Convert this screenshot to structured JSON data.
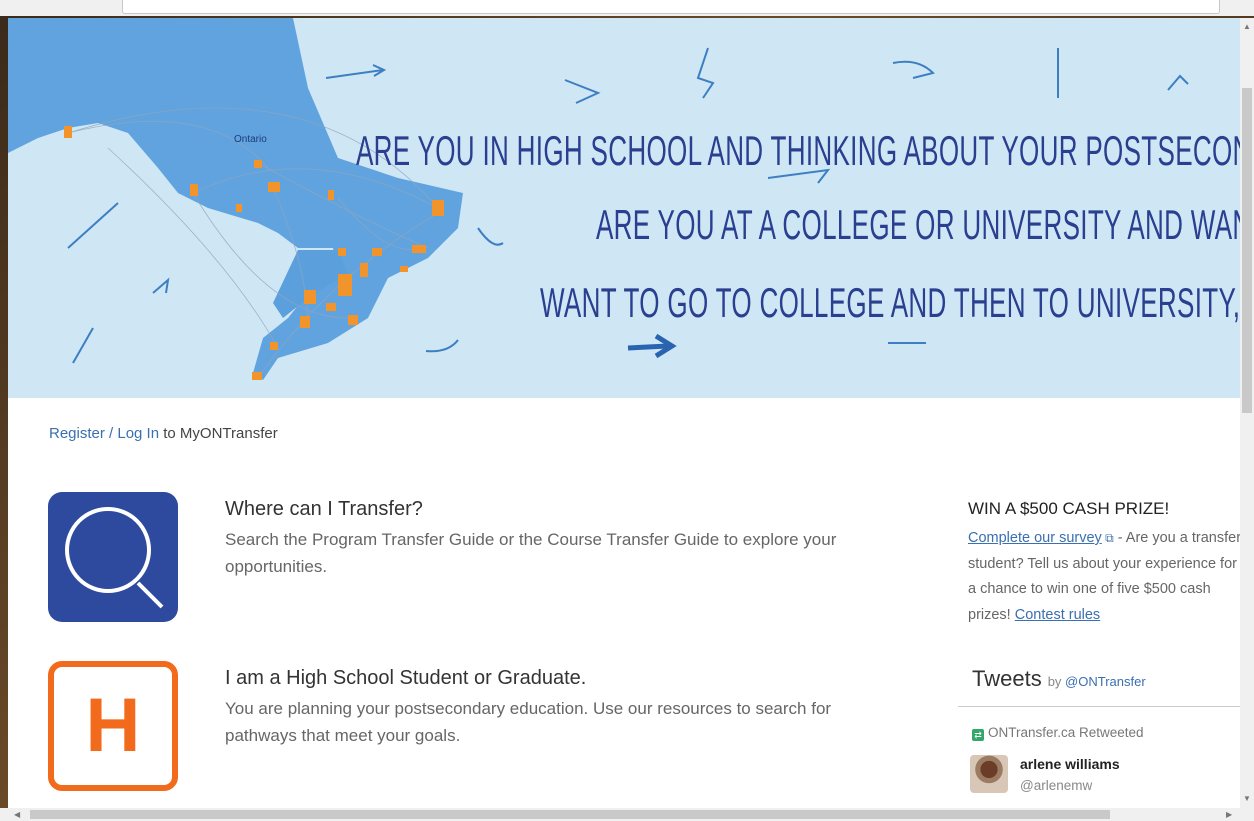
{
  "banner": {
    "region_label": "Ontario",
    "lines": [
      "ARE YOU IN HIGH SCHOOL AND THINKING ABOUT YOUR  POSTSECONDARY EDUCA",
      "ARE YOU AT A COLLEGE OR UNIVERSITY AND WANT TO SWI",
      "WANT TO GO TO COLLEGE AND THEN TO UNIVERSITY, OR VICE-VI"
    ]
  },
  "login": {
    "link_text": "Register / Log In",
    "suffix": " to MyONTransfer"
  },
  "features": [
    {
      "icon": "search-icon",
      "icon_color": "#2e4a9e",
      "title": "Where can I Transfer?",
      "description": "Search the Program Transfer Guide or the Course Transfer Guide to explore your opportunities."
    },
    {
      "icon": "h-letter-icon",
      "icon_letter": "H",
      "icon_color": "#f26a1b",
      "title": "I am a High School Student or Graduate.",
      "description": "You are planning your postsecondary education. Use our resources to search for pathways that meet your goals."
    }
  ],
  "promo": {
    "title": "WIN A $500 CASH PRIZE!",
    "survey_link": "Complete our survey",
    "body": " - Are you a transfer student? Tell us about your experience for a chance to win one of five $500 cash prizes! ",
    "rules_link": "Contest rules"
  },
  "tweets": {
    "title": "Tweets",
    "by_prefix": "by ",
    "handle": "@ONTransfer",
    "retweeted_text": "ONTransfer.ca Retweeted",
    "tweet_name": "arlene williams",
    "tweet_handle": "@arlenemw"
  },
  "colors": {
    "banner_bg": "#cfe7f5",
    "map_fill": "#5b9fdc",
    "marker": "#f0942b",
    "headline": "#2a3f8f",
    "link": "#3a6fb0"
  }
}
